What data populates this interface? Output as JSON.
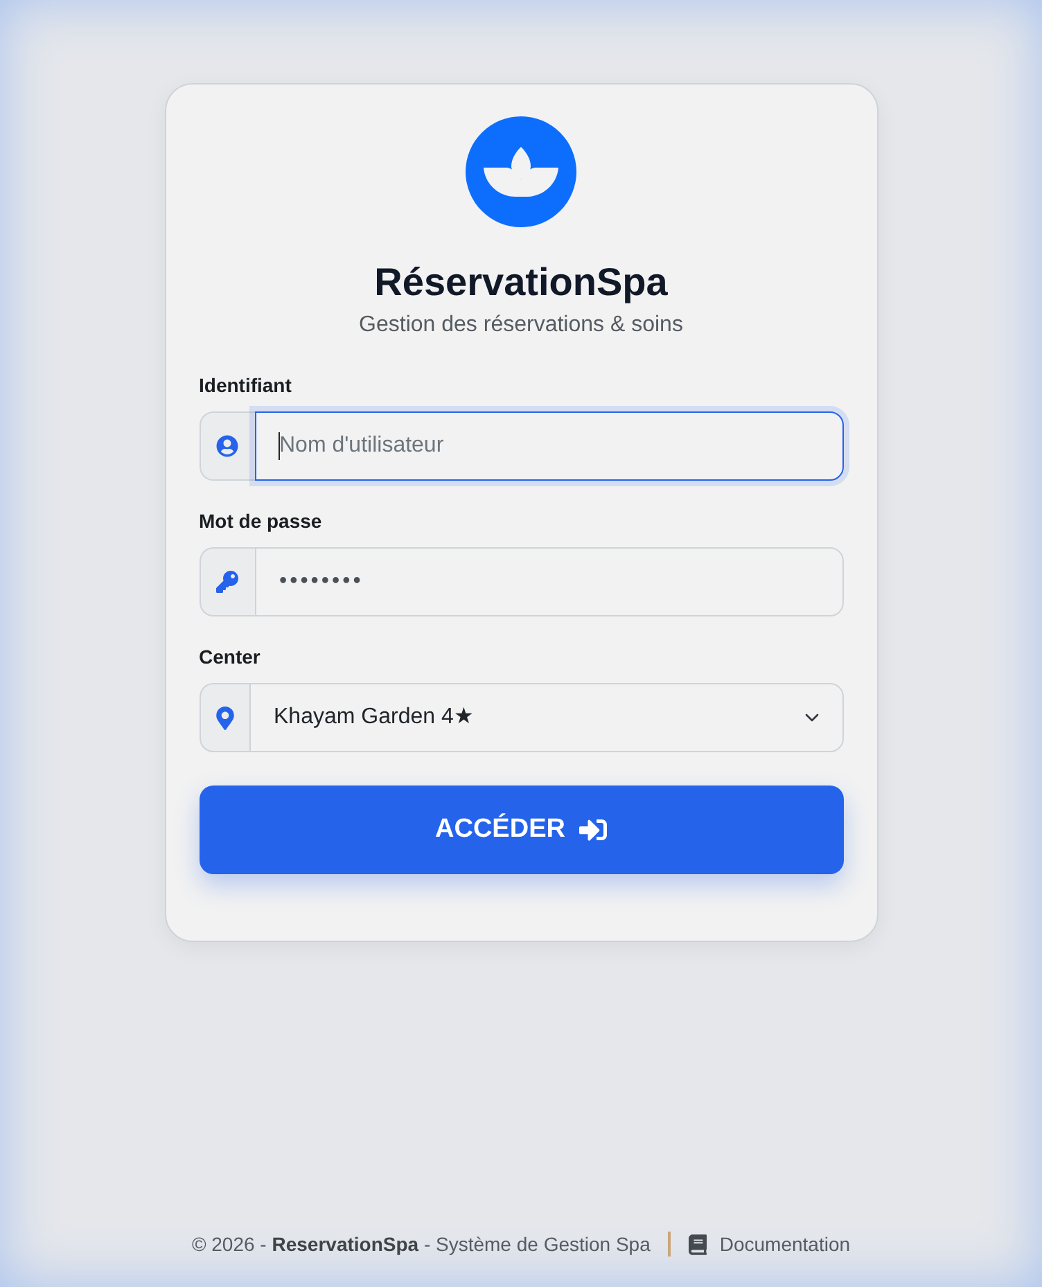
{
  "brand": {
    "title": "RéservationSpa",
    "subtitle": "Gestion des réservations & soins"
  },
  "fields": [
    {
      "kind": "text",
      "label": "Identifiant",
      "placeholder": "Nom d'utilisateur",
      "focused": true
    },
    {
      "kind": "password",
      "label": "Mot de passe",
      "value": "••••••••",
      "focused": false
    },
    {
      "kind": "select",
      "label": "Center",
      "value": "Khayam Garden 4★",
      "focused": false
    }
  ],
  "submit_button": {
    "label": "ACCÉDER"
  },
  "footer": {
    "copyright": "© 2026 - **ReservationSpa** - Système de Gestion Spa",
    "link": "Documentation"
  }
}
